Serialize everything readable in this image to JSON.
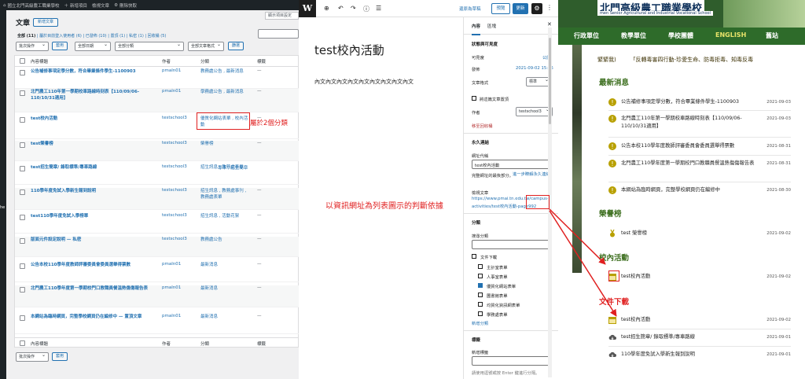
{
  "admin_bar": {
    "site_name": "國立北門高級農工職業學校",
    "new_item": "新增項目",
    "view_post": "檢視文章",
    "clear_cache": "刪除快取"
  },
  "left_edge_label": "he",
  "list": {
    "page_title": "文章",
    "add_new": "新增文章",
    "screen_options": "顯示項目設定",
    "views": {
      "all": "全部",
      "all_count": "(11)",
      "mine": "屬於目前登入使用者",
      "mine_count": "(6)",
      "published": "已發佈",
      "published_count": "(10)",
      "pinned": "置頂",
      "pinned_count": "(1)",
      "private": "私密",
      "private_count": "(1)",
      "trash": "回收桶",
      "trash_count": "(5)"
    },
    "bulk_action": "批次操作",
    "apply": "套用",
    "date_filter": "全部日期",
    "category_filter": "全部分類",
    "format_filter": "全部文章格式",
    "filter_button": "篩選",
    "col_title": "內容標題",
    "col_author": "作者",
    "col_category": "分類",
    "col_tags": "標籤",
    "rows": [
      {
        "title": "公告補修事項定學分數，符合畢業條件學生-1100903",
        "author": "pmaln01",
        "category": "教務處公告 , 最新消息",
        "tags": "—"
      },
      {
        "title": "北門農工110年第一學期校車路線時刻表【110/09/06-110/10/31適用】",
        "author": "pmaln01",
        "category": "學務處公告 , 最新消息",
        "tags": "—"
      },
      {
        "title": "test校內活動",
        "author": "testschool3",
        "category": "優質化網站表單 , 校內活動",
        "tags": "—"
      },
      {
        "title": "test榮譽榜",
        "author": "testschool3",
        "category": "榮譽榜",
        "tags": "—"
      },
      {
        "title": "test招生簡章/ 錄取標準/專車路線",
        "author": "testschool3",
        "category": "招生訊息 , 教務處表單",
        "tags": "專車 , 招生簡章"
      },
      {
        "title": "110學年度免試入學新生報到說明",
        "author": "testschool3",
        "category": "招生訊息 , 教務處事刊 , 教務處表單",
        "tags": "—"
      },
      {
        "title": "test110學年度免試入學榜單",
        "author": "testschool3",
        "category": "招生訊息 , 活動花絮",
        "tags": "—"
      },
      {
        "title": "版面元件設定說明 — 私密",
        "author": "testschool3",
        "category": "教務處公告",
        "tags": "—"
      },
      {
        "title": "公告本校110學年度教師評審委員會委員選舉得票數",
        "author": "pmaln01",
        "category": "最新消息",
        "tags": "—"
      },
      {
        "title": "北門農工110學年度第一學期校門口教職員餐溫熱傷傷報告表",
        "author": "pmaln01",
        "category": "最新消息",
        "tags": "—"
      },
      {
        "title": "本網站為臨時網頁，完整學校網頁仍在編修中 — 置頂文章",
        "author": "pmaln01",
        "category": "最新消息",
        "tags": "—"
      }
    ]
  },
  "annotations": {
    "two_categories": "屬於2個分類",
    "url_basis": "以資訊網址為列表圖示的判斷依據"
  },
  "editor": {
    "save_draft": "還原為草稿",
    "preview": "預覽",
    "update": "更新",
    "post_title": "test校內活動",
    "post_body": "內文內文內文內文內文內文內文內文內文",
    "sidebar": {
      "tab_post": "內容",
      "tab_block": "區塊",
      "status_heading": "狀態與可見度",
      "visibility_label": "可見度",
      "visibility_value": "公開",
      "publish_label": "發佈",
      "publish_value": "2021-09-02 15:26",
      "format_label": "文章格式",
      "format_value": "標準",
      "sticky_label": "將這篇文章置頂",
      "author_label": "作者",
      "author_value": "testschool3",
      "trash_link": "移至回收桶",
      "permalink_heading": "永久連結",
      "url_label": "網址代稱",
      "url_value": "test校內活動",
      "url_help": "完整網址的最後部分。",
      "url_help_link": "進一步瞭解永久連結",
      "view_post_label": "檢視文章",
      "view_post_url_a": "https://www.pmai.tn.edu.tw/campus-",
      "view_post_url_b": "activities/test校內活動-page992",
      "categories_heading": "分類",
      "search_categories": "搜尋分類",
      "cat_items": [
        {
          "label": "文件下載",
          "checked": false
        },
        {
          "label": "主計室表單",
          "checked": false
        },
        {
          "label": "人事室表單",
          "checked": false
        },
        {
          "label": "優質化網站表單",
          "checked": true
        },
        {
          "label": "圖書館表單",
          "checked": false
        },
        {
          "label": "均質化資訊網表單",
          "checked": false
        },
        {
          "label": "學務處表單",
          "checked": false
        }
      ],
      "add_category": "新增分類",
      "tags_heading": "標籤",
      "add_tag": "新增標籤",
      "tag_help": "請使用逗號或按 Enter 鍵進行分隔。"
    }
  },
  "site": {
    "school_name": "北門高級農工職業學校",
    "school_name_en": "men Senior Agricultural and Industrial Vocational School",
    "nav": [
      "行政單位",
      "教學單位",
      "學校團體",
      "ENGLISH",
      "舊站"
    ],
    "marquee_left": "緊緊我)",
    "marquee_right": "「反轉毒害四行動-珍愛生命、防毒拒毒、知毒反毒",
    "latest_heading": "最新消息",
    "latest": [
      {
        "text": "公告補修事項定學分數，符合畢業條件學生-1100903",
        "date": "2021-09-03"
      },
      {
        "text": "北門農工110年第一學期校車路線時刻表【110/09/06-110/10/31適用】",
        "date": "2021-09-03"
      },
      {
        "text": "公告本校110學年度教師評審委員會委員選舉得票數",
        "date": "2021-08-31"
      },
      {
        "text": "北門農工110學年度第一學期校門口教職員餐溫熱傷傷報告表",
        "date": "2021-08-31"
      },
      {
        "text": "本網站為臨時網頁，完整學校網頁仍在編修中",
        "date": "2021-08-30"
      }
    ],
    "honor_heading": "榮譽榜",
    "honor": [
      {
        "text": "test 榮譽榜",
        "date": "2021-09-02"
      }
    ],
    "campus_heading": "校內活動",
    "campus": [
      {
        "text": "test校內活動",
        "date": "2021-09-02"
      }
    ],
    "download_heading": "文件下載",
    "downloads": [
      {
        "text": "test校內活動",
        "date": "2021-09-02"
      },
      {
        "text": "test招生簡章/ 錄取標準/專車路線",
        "date": "2021-09-01"
      },
      {
        "text": "110學年度免試入學新生報到說明",
        "date": "2021-09-01"
      }
    ]
  }
}
